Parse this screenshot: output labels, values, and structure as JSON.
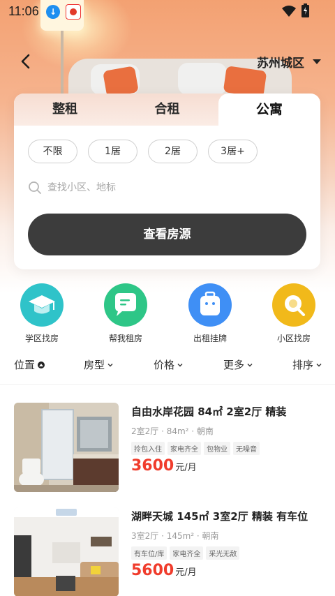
{
  "status_bar": {
    "time": "11:06",
    "icons": [
      "download-icon",
      "app-notification-icon",
      "wifi-icon",
      "battery-icon"
    ]
  },
  "header": {
    "city": "苏州城区"
  },
  "rent_tabs": [
    {
      "label": "整租",
      "active": false
    },
    {
      "label": "合租",
      "active": false
    },
    {
      "label": "公寓",
      "active": true
    }
  ],
  "room_filters": [
    "不限",
    "1居",
    "2居",
    "3居+"
  ],
  "search": {
    "placeholder": "查找小区、地标"
  },
  "view_button": "查看房源",
  "quick_entries": [
    {
      "label": "学区找房",
      "icon": "graduation-cap-icon",
      "color": "#2fc3c9"
    },
    {
      "label": "帮我租房",
      "icon": "chat-bubble-icon",
      "color": "#2ec687"
    },
    {
      "label": "出租挂牌",
      "icon": "suitcase-icon",
      "color": "#3f8ff5"
    },
    {
      "label": "小区找房",
      "icon": "magnifier-icon",
      "color": "#f1b91a"
    }
  ],
  "sort_filters": [
    {
      "label": "位置",
      "state": "expanded"
    },
    {
      "label": "房型",
      "state": "collapsed"
    },
    {
      "label": "价格",
      "state": "collapsed"
    },
    {
      "label": "更多",
      "state": "collapsed"
    },
    {
      "label": "排序",
      "state": "collapsed"
    }
  ],
  "listings": [
    {
      "title": "自由水岸花园 84㎡ 2室2厅 精装",
      "meta": "2室2厅 · 84m² · 朝南",
      "tags": [
        "拎包入住",
        "家电齐全",
        "包物业",
        "无噪音"
      ],
      "price": "3600",
      "unit": "元/月"
    },
    {
      "title": "湖畔天城 145㎡ 3室2厅 精装 有车位",
      "meta": "3室2厅 · 145m² · 朝南",
      "tags": [
        "有车位/库",
        "家电齐全",
        "采光无敌"
      ],
      "price": "5600",
      "unit": "元/月"
    }
  ],
  "colors": {
    "accent_price": "#f03c2c",
    "primary_button": "#3c3c3c",
    "hero_orange": "#f3a172"
  }
}
